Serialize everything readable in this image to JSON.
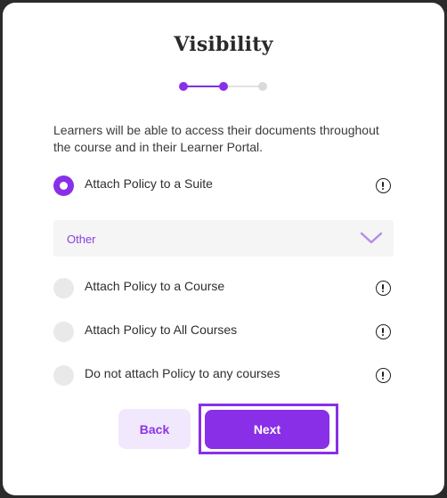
{
  "modal": {
    "title": "Visibility",
    "description": "Learners will be able to access their documents throughout the course and in their Learner Portal."
  },
  "stepper": {
    "total_steps": 3,
    "current_step": 2
  },
  "options": [
    {
      "label": "Attach Policy to a Suite",
      "checked": true,
      "icon": "info-icon"
    },
    {
      "label": "Attach Policy to a Course",
      "checked": false,
      "icon": "info-icon"
    },
    {
      "label": "Attach Policy to All Courses",
      "checked": false,
      "icon": "info-icon"
    },
    {
      "label": "Do not attach Policy to any courses",
      "checked": false,
      "icon": "info-icon"
    }
  ],
  "suite_select": {
    "value": "Other",
    "icon": "chevron-down-icon"
  },
  "buttons": {
    "back_label": "Back",
    "next_label": "Next"
  },
  "colors": {
    "accent": "#8a2fe8",
    "accent_light": "#f1e8fd",
    "inactive": "#e9e9e9"
  }
}
